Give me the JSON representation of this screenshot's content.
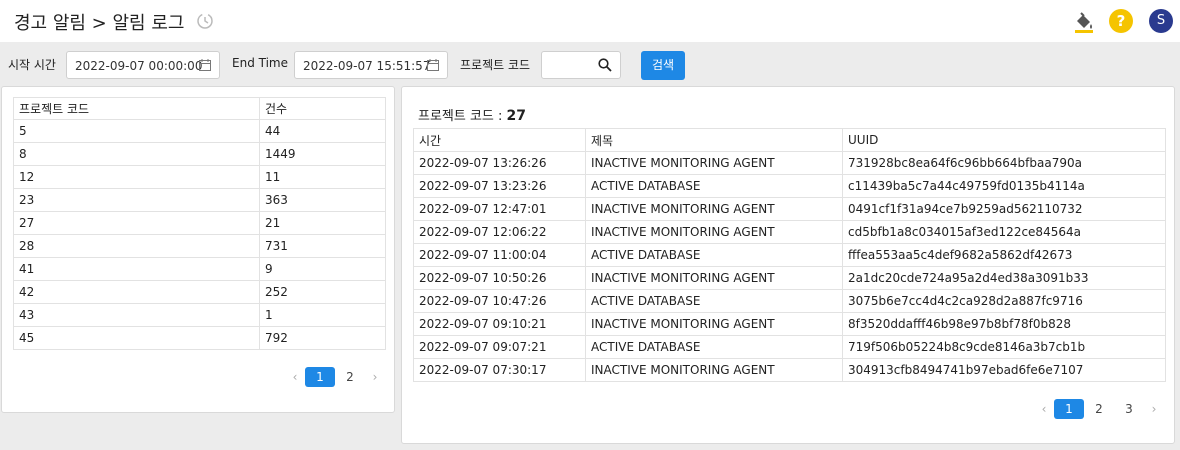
{
  "header": {
    "title": "경고 알림 > 알림 로그",
    "avatar_letter": "S",
    "help_symbol": "?"
  },
  "filters": {
    "start_label": "시작 시간",
    "start_value": "2022-09-07 00:00:00",
    "end_label": "End Time",
    "end_value": "2022-09-07 15:51:57",
    "project_label": "프로젝트 코드",
    "project_value": "",
    "search_button": "검색"
  },
  "summary_table": {
    "columns": [
      "프로젝트 코드",
      "건수"
    ],
    "rows": [
      [
        "5",
        "44"
      ],
      [
        "8",
        "1449"
      ],
      [
        "12",
        "11"
      ],
      [
        "23",
        "363"
      ],
      [
        "27",
        "21"
      ],
      [
        "28",
        "731"
      ],
      [
        "41",
        "9"
      ],
      [
        "42",
        "252"
      ],
      [
        "43",
        "1"
      ],
      [
        "45",
        "792"
      ]
    ],
    "pages": [
      "1",
      "2"
    ],
    "active_page": "1"
  },
  "detail": {
    "title_label": "프로젝트 코드 :",
    "title_value": "27",
    "columns": [
      "시간",
      "제목",
      "UUID"
    ],
    "rows": [
      [
        "2022-09-07 13:26:26",
        "INACTIVE MONITORING AGENT",
        "731928bc8ea64f6c96bb664bfbaa790a"
      ],
      [
        "2022-09-07 13:23:26",
        "ACTIVE DATABASE",
        "c11439ba5c7a44c49759fd0135b4114a"
      ],
      [
        "2022-09-07 12:47:01",
        "INACTIVE MONITORING AGENT",
        "0491cf1f31a94ce7b9259ad562110732"
      ],
      [
        "2022-09-07 12:06:22",
        "INACTIVE MONITORING AGENT",
        "cd5bfb1a8c034015af3ed122ce84564a"
      ],
      [
        "2022-09-07 11:00:04",
        "ACTIVE DATABASE",
        "fffea553aa5c4def9682a5862df42673"
      ],
      [
        "2022-09-07 10:50:26",
        "INACTIVE MONITORING AGENT",
        "2a1dc20cde724a95a2d4ed38a3091b33"
      ],
      [
        "2022-09-07 10:47:26",
        "ACTIVE DATABASE",
        "3075b6e7cc4d4c2ca928d2a887fc9716"
      ],
      [
        "2022-09-07 09:10:21",
        "INACTIVE MONITORING AGENT",
        "8f3520ddafff46b98e97b8bf78f0b828"
      ],
      [
        "2022-09-07 09:07:21",
        "ACTIVE DATABASE",
        "719f506b05224b8c9cde8146a3b7cb1b"
      ],
      [
        "2022-09-07 07:30:17",
        "INACTIVE MONITORING AGENT",
        "304913cfb8494741b97ebad6fe6e7107"
      ]
    ],
    "pages": [
      "1",
      "2",
      "3"
    ],
    "active_page": "1"
  },
  "icons": {
    "history": "history-icon",
    "paint": "paint-bucket-icon",
    "help": "help-icon",
    "calendar": "calendar-icon",
    "search": "search-icon",
    "prev": "chevron-left-icon",
    "next": "chevron-right-icon"
  },
  "colors": {
    "accent": "#1e88e5",
    "help": "#f5c400",
    "avatar": "#2a3a8f"
  }
}
